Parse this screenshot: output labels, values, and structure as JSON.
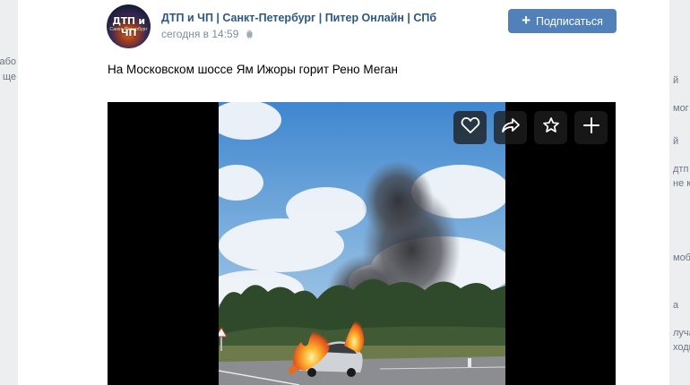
{
  "background": {
    "left_fragments": [
      "або",
      "ще"
    ],
    "right_fragments": [
      "й",
      "мог",
      "й",
      "дтп",
      "не к",
      "моб",
      "а",
      "луча",
      "ходи"
    ]
  },
  "post": {
    "group_name": "ДТП и ЧП | Санкт-Петербург | Питер Онлайн | СПб",
    "time": "сегодня в 14:59",
    "text": "На Московском шоссе Ям Ижоры горит Рено Меган",
    "avatar": {
      "title": "ДТП и ЧП",
      "subtitle": "Санкт-Петербург"
    }
  },
  "subscribe": {
    "label": "Подписаться"
  },
  "media_actions": [
    "heart-icon",
    "share-icon",
    "star-icon",
    "plus-icon"
  ],
  "colors": {
    "accent": "#5181b8",
    "link": "#2a5885",
    "muted": "#818c99"
  }
}
